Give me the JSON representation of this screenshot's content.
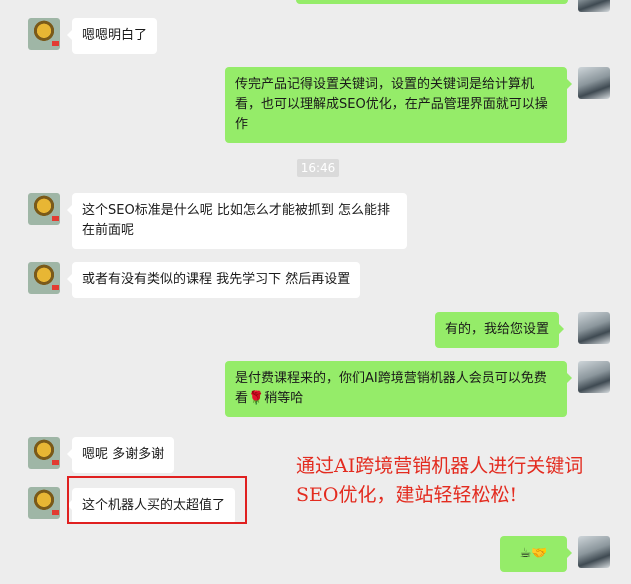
{
  "colors": {
    "background": "#ededed",
    "self_bubble": "#95ec69",
    "other_bubble": "#ffffff",
    "annotation": "#e32b1f"
  },
  "messages": [
    {
      "side": "left",
      "text": "嗯嗯明白了"
    },
    {
      "side": "right",
      "text": "传完产品记得设置关键词，设置的关键词是给计算机看，也可以理解成SEO优化，在产品管理界面就可以操作"
    },
    {
      "side": "left",
      "text": "这个SEO标准是什么呢 比如怎么才能被抓到 怎么能排在前面呢"
    },
    {
      "side": "left",
      "text": "或者有没有类似的课程 我先学习下 然后再设置"
    },
    {
      "side": "right",
      "text": "有的，我给您设置"
    },
    {
      "side": "right",
      "text_before": "是付费课程来的，你们AI跨境营销机器人会员可以免费看",
      "emoji": "🌹",
      "text_after": "稍等哈"
    },
    {
      "side": "left",
      "text": "嗯呢 多谢多谢"
    },
    {
      "side": "left",
      "text": "这个机器人买的太超值了"
    },
    {
      "side": "right",
      "text": "☕🤝"
    }
  ],
  "timestamp": "16:46",
  "annotation": {
    "line1": "通过AI跨境营销机器人进行关键词",
    "line2": "SEO优化，建站轻轻松松!"
  }
}
